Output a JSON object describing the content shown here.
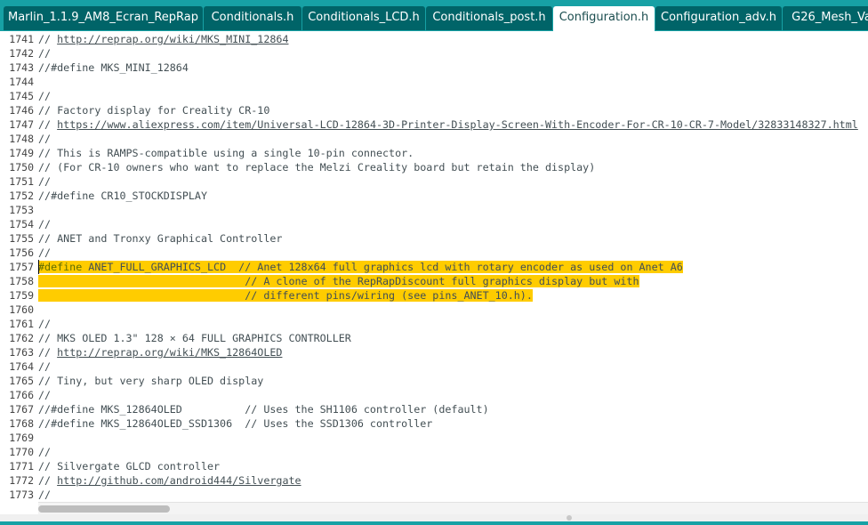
{
  "tabs": [
    {
      "label": "Marlin_1.1.9_AM8_Ecran_RepRap",
      "active": false
    },
    {
      "label": "Conditionals.h",
      "active": false
    },
    {
      "label": "Conditionals_LCD.h",
      "active": false
    },
    {
      "label": "Conditionals_post.h",
      "active": false
    },
    {
      "label": "Configuration.h",
      "active": true
    },
    {
      "label": "Configuration_adv.h",
      "active": false
    },
    {
      "label": "G26_Mesh_Va",
      "active": false
    }
  ],
  "editor": {
    "lines": [
      {
        "num": "1741",
        "segments": [
          {
            "t": "// "
          },
          {
            "t": "http://reprap.org/wiki/MKS_MINI_12864",
            "c": "link"
          }
        ]
      },
      {
        "num": "1742",
        "segments": [
          {
            "t": "//"
          }
        ]
      },
      {
        "num": "1743",
        "segments": [
          {
            "t": "//#define MKS_MINI_12864"
          }
        ]
      },
      {
        "num": "1744",
        "segments": []
      },
      {
        "num": "1745",
        "segments": [
          {
            "t": "//"
          }
        ]
      },
      {
        "num": "1746",
        "segments": [
          {
            "t": "// Factory display for Creality CR-10"
          }
        ]
      },
      {
        "num": "1747",
        "segments": [
          {
            "t": "// "
          },
          {
            "t": "https://www.aliexpress.com/item/Universal-LCD-12864-3D-Printer-Display-Screen-With-Encoder-For-CR-10-CR-7-Model/32833148327.html",
            "c": "link"
          }
        ]
      },
      {
        "num": "1748",
        "segments": [
          {
            "t": "//"
          }
        ]
      },
      {
        "num": "1749",
        "segments": [
          {
            "t": "// This is RAMPS-compatible using a single 10-pin connector."
          }
        ]
      },
      {
        "num": "1750",
        "segments": [
          {
            "t": "// (For CR-10 owners who want to replace the Melzi Creality board but retain the display)"
          }
        ]
      },
      {
        "num": "1751",
        "segments": [
          {
            "t": "//"
          }
        ]
      },
      {
        "num": "1752",
        "segments": [
          {
            "t": "//#define CR10_STOCKDISPLAY"
          }
        ]
      },
      {
        "num": "1753",
        "segments": []
      },
      {
        "num": "1754",
        "segments": [
          {
            "t": "//"
          }
        ]
      },
      {
        "num": "1755",
        "segments": [
          {
            "t": "// ANET and Tronxy Graphical Controller"
          }
        ]
      },
      {
        "num": "1756",
        "segments": [
          {
            "t": "//"
          }
        ]
      },
      {
        "num": "1757",
        "highlight": true,
        "segments": [
          {
            "t": "#define",
            "c": "kw"
          },
          {
            "t": " ANET_FULL_GRAPHICS_LCD  // Anet 128x64 full graphics lcd with rotary encoder as used on Anet A6"
          }
        ]
      },
      {
        "num": "1758",
        "highlight": true,
        "segments": [
          {
            "t": "                                 // A clone of the RepRapDiscount full graphics display but with"
          }
        ]
      },
      {
        "num": "1759",
        "highlight": true,
        "segments": [
          {
            "t": "                                 // different pins/wiring (see pins_ANET_10.h)."
          }
        ]
      },
      {
        "num": "1760",
        "segments": []
      },
      {
        "num": "1761",
        "segments": [
          {
            "t": "//"
          }
        ]
      },
      {
        "num": "1762",
        "segments": [
          {
            "t": "// MKS OLED 1.3\" 128 × 64 FULL GRAPHICS CONTROLLER"
          }
        ]
      },
      {
        "num": "1763",
        "segments": [
          {
            "t": "// "
          },
          {
            "t": "http://reprap.org/wiki/MKS_12864OLED",
            "c": "link"
          }
        ]
      },
      {
        "num": "1764",
        "segments": [
          {
            "t": "//"
          }
        ]
      },
      {
        "num": "1765",
        "segments": [
          {
            "t": "// Tiny, but very sharp OLED display"
          }
        ]
      },
      {
        "num": "1766",
        "segments": [
          {
            "t": "//"
          }
        ]
      },
      {
        "num": "1767",
        "segments": [
          {
            "t": "//#define MKS_12864OLED          // Uses the SH1106 controller (default)"
          }
        ]
      },
      {
        "num": "1768",
        "segments": [
          {
            "t": "//#define MKS_12864OLED_SSD1306  // Uses the SSD1306 controller"
          }
        ]
      },
      {
        "num": "1769",
        "segments": []
      },
      {
        "num": "1770",
        "segments": [
          {
            "t": "//"
          }
        ]
      },
      {
        "num": "1771",
        "segments": [
          {
            "t": "// Silvergate GLCD controller"
          }
        ]
      },
      {
        "num": "1772",
        "segments": [
          {
            "t": "// "
          },
          {
            "t": "http://github.com/android444/Silvergate",
            "c": "link"
          }
        ]
      },
      {
        "num": "1773",
        "segments": [
          {
            "t": "//"
          }
        ]
      }
    ]
  },
  "colors": {
    "accent": "#17a1a5",
    "tab_inactive": "#006468",
    "highlight": "#ffcc00",
    "keyword": "#5e6d03"
  }
}
